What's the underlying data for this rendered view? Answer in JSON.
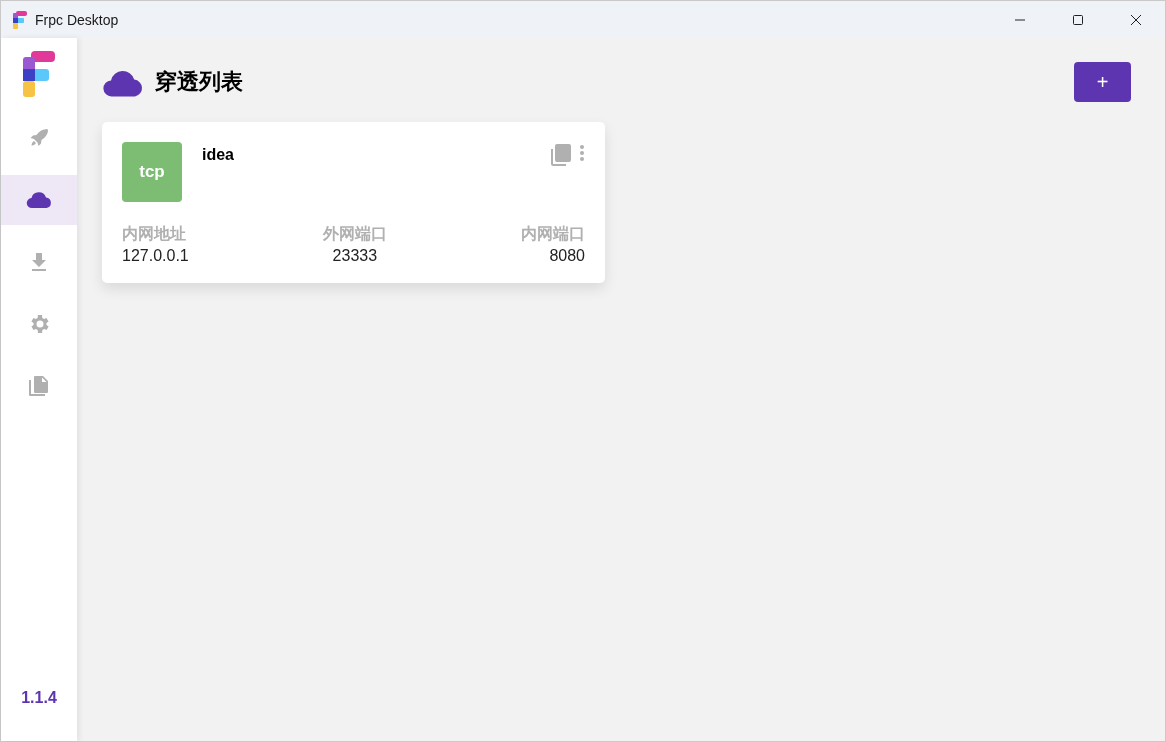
{
  "window": {
    "title": "Frpc Desktop"
  },
  "sidebar": {
    "items": [
      {
        "selected": false
      },
      {
        "selected": true
      },
      {
        "selected": false
      },
      {
        "selected": false
      },
      {
        "selected": false
      }
    ],
    "version": "1.1.4"
  },
  "header": {
    "title": "穿透列表",
    "add_button": "+"
  },
  "proxies": [
    {
      "type": "tcp",
      "name": "idea",
      "fields": [
        {
          "label": "内网地址",
          "value": "127.0.0.1"
        },
        {
          "label": "外网端口",
          "value": "23333"
        },
        {
          "label": "内网端口",
          "value": "8080"
        }
      ]
    }
  ]
}
